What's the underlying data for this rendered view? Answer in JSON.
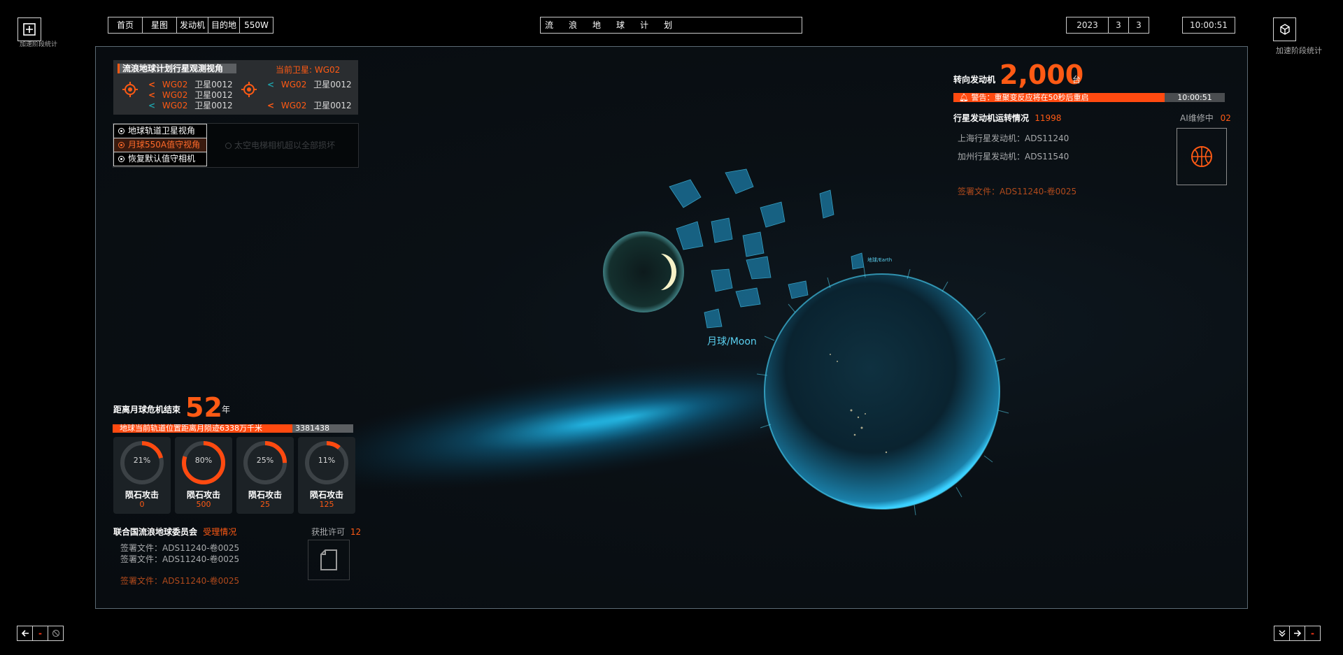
{
  "nav": {
    "tabs": [
      "首页",
      "星图",
      "发动机",
      "目的地",
      "550W"
    ],
    "title": "流浪地球计划",
    "date": {
      "year": "2023",
      "month": "3",
      "day": "3"
    },
    "time": "10:00:51"
  },
  "corners": {
    "top_left_label": "加速阶段统计",
    "top_right_label": "加速阶段统计"
  },
  "satellite_panel": {
    "title": "流浪地球计划行星观测视角",
    "current_label": "当前卫星:",
    "current_value": "WG02",
    "rows": [
      {
        "code": "WG02",
        "name": "卫星0012"
      },
      {
        "code": "WG02",
        "name": "卫星0012"
      },
      {
        "code": "WG02",
        "name": "卫星0012"
      },
      {
        "code": "WG02",
        "name": "卫星0012"
      },
      {
        "code": "WG02",
        "name": "卫星0012"
      }
    ]
  },
  "camera_menu": {
    "items": [
      "地球轨道卫星视角",
      "月球550A值守视角",
      "恢复默认值守相机"
    ],
    "active_index": 1,
    "hint": "太空电梯相机超以全部损坏"
  },
  "engine_panel": {
    "label": "转向发动机",
    "count": "2,000",
    "unit": "台",
    "warning": "警告：重聚变反应将在50秒后重启",
    "warning_time": "10:00:51",
    "status_label": "行星发动机运转情况",
    "status_value": "11998",
    "ai_label": "AI维修中",
    "ai_value": "02",
    "engines": [
      "上海行星发动机：ADS11240",
      "加州行星发动机：ADS11540"
    ],
    "signed_doc": "签署文件：ADS11240-卷0025"
  },
  "scene": {
    "moon_label": "月球/Moon",
    "earth_label": "地球/Earth"
  },
  "crisis_panel": {
    "label": "距离月球危机结束",
    "years": "52",
    "unit": "年",
    "distance_text": "地球当前轨道位置距离月陨迹6338万千米",
    "distance_value": "3381438",
    "gauges": [
      {
        "percent": 21,
        "percent_label": "21%",
        "label": "陨石攻击",
        "value": "0"
      },
      {
        "percent": 80,
        "percent_label": "80%",
        "label": "陨石攻击",
        "value": "500"
      },
      {
        "percent": 25,
        "percent_label": "25%",
        "label": "陨石攻击",
        "value": "25"
      },
      {
        "percent": 11,
        "percent_label": "11%",
        "label": "陨石攻击",
        "value": "125"
      }
    ]
  },
  "un_panel": {
    "label": "联合国流浪地球委员会",
    "status": "受理情况",
    "approval_label": "获批许可",
    "approval_value": "12",
    "docs": [
      "签署文件：ADS11240-卷0025",
      "签署文件：ADS11240-卷0025"
    ],
    "highlight_doc": "签署文件：ADS11240-卷0025"
  },
  "colors": {
    "accent": "#ff5a14",
    "teal": "#1fa0a8",
    "earth_glow": "#1ab4e6"
  }
}
